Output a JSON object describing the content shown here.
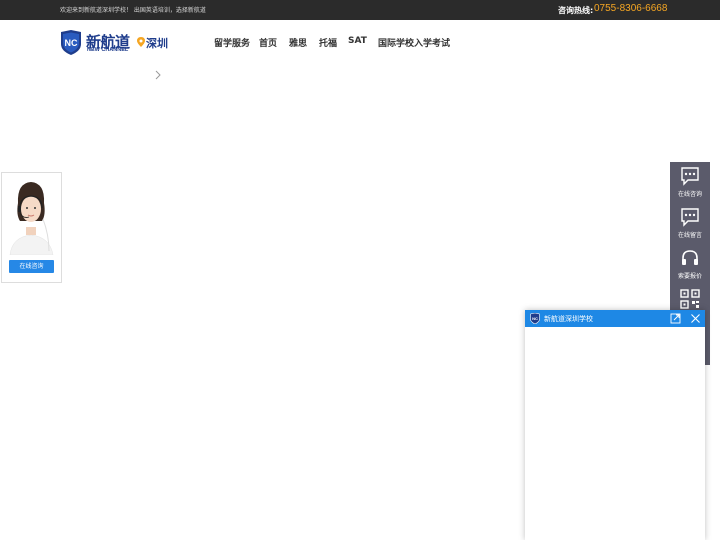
{
  "topbar": {
    "welcome": "欢迎来到新航道深圳学校！ 出国英语培训，选择新航道",
    "hotline_label": "咨询热线:",
    "hotline_number": "0755-8306-6668"
  },
  "header": {
    "logo_text_cn": "新航道",
    "logo_text_en": "NEW CHANNEL",
    "logo_badge": "NC",
    "city": "深圳"
  },
  "nav": {
    "items": [
      {
        "label": "留学服务"
      },
      {
        "label": "首页"
      },
      {
        "label": "雅思"
      },
      {
        "label": "托福"
      },
      {
        "label": "SAT"
      },
      {
        "label": "国际学校入学考试"
      }
    ]
  },
  "consultant_widget": {
    "button_label": "在线咨询"
  },
  "side_rail": {
    "items": [
      {
        "label": "在线咨询",
        "icon": "chat-bubble-icon"
      },
      {
        "label": "在线留言",
        "icon": "message-icon"
      },
      {
        "label": "索要报价",
        "icon": "headset-icon"
      },
      {
        "label": "",
        "icon": "qr-code-icon"
      }
    ]
  },
  "chat_window": {
    "title": "新航道深圳学校",
    "header_color": "#1e88e5"
  },
  "colors": {
    "topbar_bg": "#2b2b2b",
    "hotline": "#f5a623",
    "brand_blue": "#1f3d8c",
    "accent_blue": "#2688e6",
    "rail_bg": "#5b5b6b"
  }
}
